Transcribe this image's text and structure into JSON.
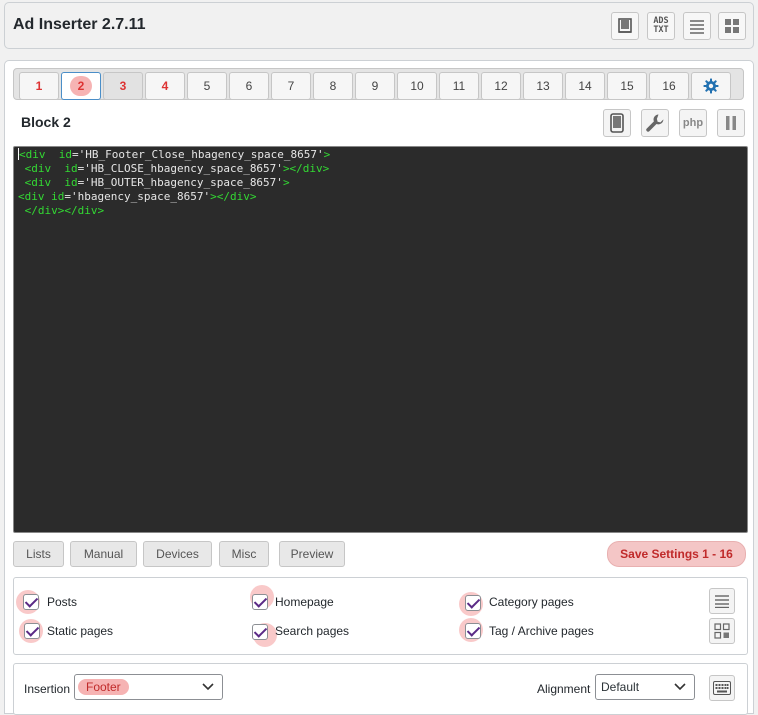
{
  "app": {
    "title": "Ad Inserter 2.7.11"
  },
  "header_buttons": [
    {
      "name": "book-icon"
    },
    {
      "name": "ads-txt-icon",
      "line1": "ADS",
      "line2": "TXT"
    },
    {
      "name": "list-icon"
    },
    {
      "name": "grid-icon"
    }
  ],
  "tabs": [
    "1",
    "2",
    "3",
    "4",
    "5",
    "6",
    "7",
    "8",
    "9",
    "10",
    "11",
    "12",
    "13",
    "14",
    "15",
    "16"
  ],
  "active_tab": "2",
  "block": {
    "title": "Block 2",
    "php_label": "php"
  },
  "code_lines": [
    [
      {
        "t": "<div",
        "c": "kw"
      },
      {
        "t": "  id",
        "c": "at"
      },
      {
        "t": "=",
        "c": "st"
      },
      {
        "t": "'HB_Footer_Close_hbagency_space_8657'",
        "c": "st"
      },
      {
        "t": ">",
        "c": "kw"
      }
    ],
    [
      {
        "t": " <div",
        "c": "kw"
      },
      {
        "t": "  id",
        "c": "at"
      },
      {
        "t": "=",
        "c": "st"
      },
      {
        "t": "'HB_CLOSE_hbagency_space_8657'",
        "c": "st"
      },
      {
        "t": "></div>",
        "c": "kw"
      }
    ],
    [
      {
        "t": " <div",
        "c": "kw"
      },
      {
        "t": "  id",
        "c": "at"
      },
      {
        "t": "=",
        "c": "st"
      },
      {
        "t": "'HB_OUTER_hbagency_space_8657'",
        "c": "st"
      },
      {
        "t": ">",
        "c": "kw"
      }
    ],
    [
      {
        "t": "<div",
        "c": "kw"
      },
      {
        "t": " id",
        "c": "at"
      },
      {
        "t": "=",
        "c": "st"
      },
      {
        "t": "'hbagency_space_8657'",
        "c": "st"
      },
      {
        "t": "></div>",
        "c": "kw"
      }
    ],
    [
      {
        "t": " </div></div>",
        "c": "kw"
      }
    ]
  ],
  "section_buttons": {
    "lists": "Lists",
    "manual": "Manual",
    "devices": "Devices",
    "misc": "Misc",
    "preview": "Preview",
    "save": "Save Settings 1 - 16"
  },
  "checkboxes": {
    "posts": "Posts",
    "homepage": "Homepage",
    "category_pages": "Category pages",
    "static_pages": "Static pages",
    "search_pages": "Search pages",
    "tag_archive_pages": "Tag / Archive pages"
  },
  "insertion": {
    "label": "Insertion",
    "value": "Footer",
    "alignment_label": "Alignment",
    "alignment_value": "Default"
  },
  "colors": {
    "accent": "#4a8ec8",
    "highlight": "#f6b3b3",
    "tab_red": "#dd3333",
    "editor_bg": "#2b2b2b",
    "code_green": "#33d833",
    "settings_blue": "#2271b1"
  }
}
